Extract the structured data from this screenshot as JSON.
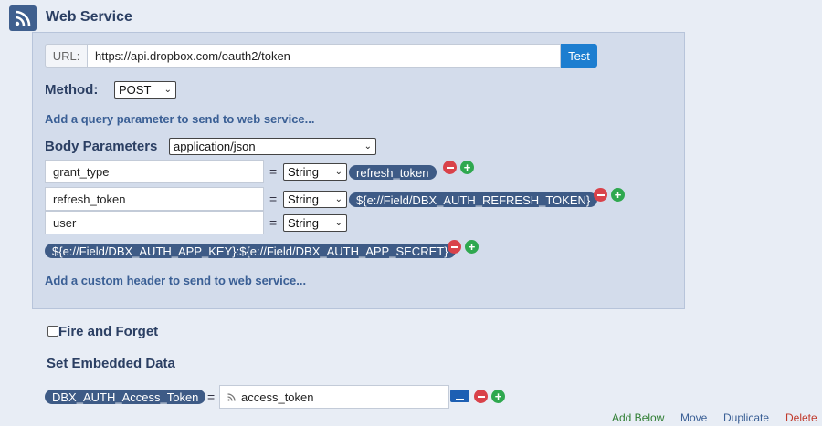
{
  "header": {
    "title": "Web Service",
    "icon": "rss-icon"
  },
  "url": {
    "label": "URL:",
    "value": "https://api.dropbox.com/oauth2/token",
    "test_label": "Test"
  },
  "method": {
    "label": "Method:",
    "value": "POST"
  },
  "links": {
    "add_query": "Add a query parameter to send to web service...",
    "add_header": "Add a custom header to send to web service..."
  },
  "body": {
    "label": "Body Parameters",
    "content_type": "application/json",
    "params": [
      {
        "key": "grant_type",
        "type": "String",
        "value": "refresh_token"
      },
      {
        "key": "refresh_token",
        "type": "String",
        "value": "${e://Field/DBX_AUTH_REFRESH_TOKEN}"
      },
      {
        "key": "user",
        "type": "String",
        "value": "${e://Field/DBX_AUTH_APP_KEY}:${e://Field/DBX_AUTH_APP_SECRET}"
      }
    ]
  },
  "fire_and_forget": {
    "label": "Fire and Forget",
    "checked": false
  },
  "embedded": {
    "label": "Set Embedded Data",
    "field": "DBX_AUTH_Access_Token",
    "equals": "=",
    "value": "access_token"
  },
  "actions": {
    "add_below": "Add Below",
    "move": "Move",
    "duplicate": "Duplicate",
    "delete": "Delete"
  },
  "colors": {
    "accent": "#1d7ed0",
    "pill": "#3e5b86",
    "minus": "#d9424a",
    "plus": "#2fa84f",
    "delete": "#c0392b",
    "add": "#2e7d32"
  }
}
